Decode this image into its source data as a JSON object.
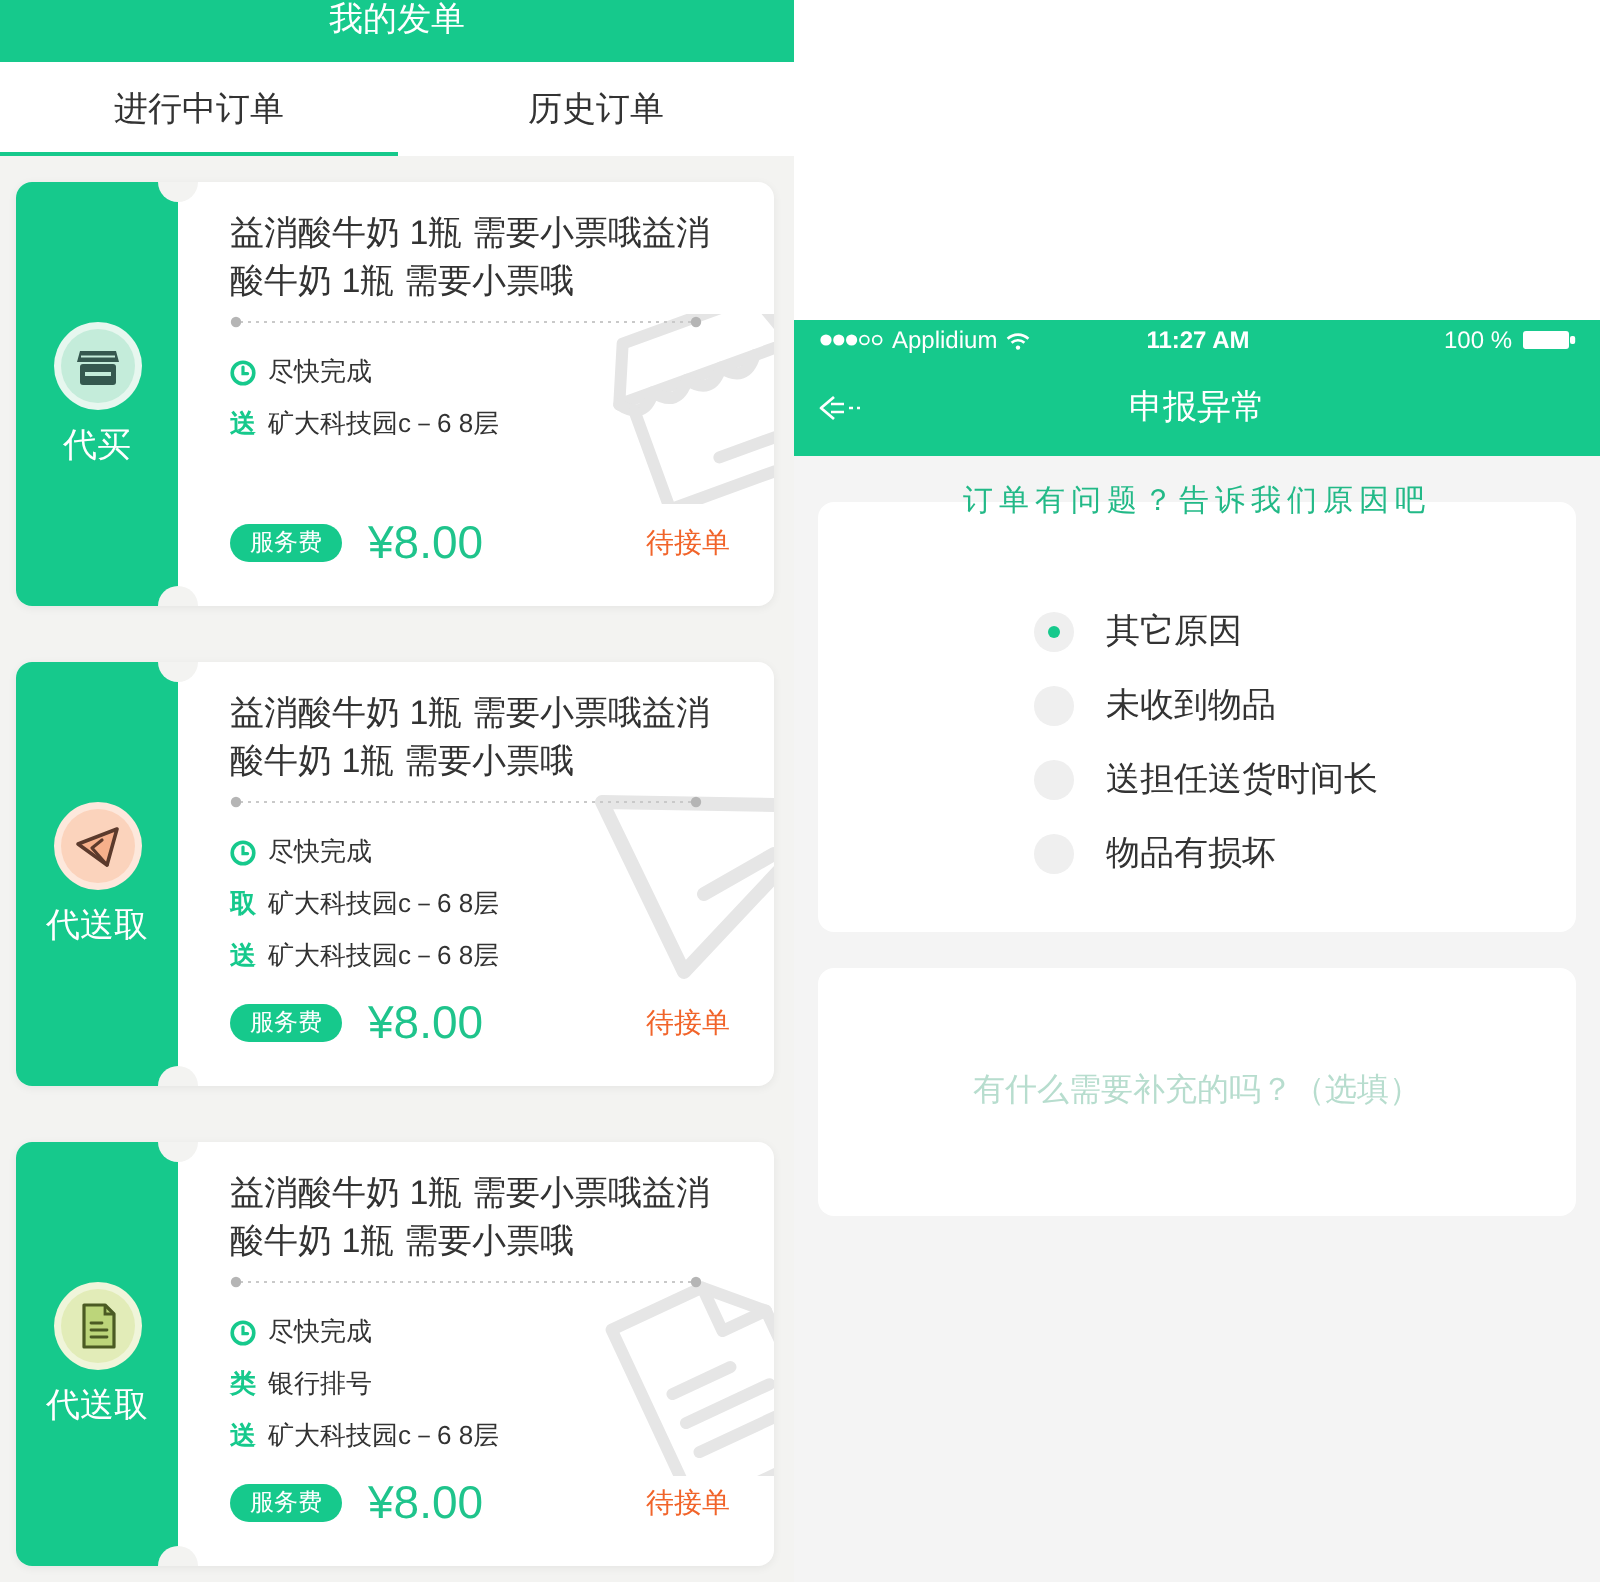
{
  "order_list": {
    "header": {
      "title": "我的发单"
    },
    "tabs": [
      {
        "label": "进行中订单",
        "selected": true
      },
      {
        "label": "历史订单",
        "selected": false
      }
    ],
    "orders": [
      {
        "kind": "shop",
        "service": "代买",
        "description": "益消酸牛奶 1瓶 需要小票哦益消酸牛奶 1瓶 需要小票哦",
        "details": [
          {
            "kind": "time",
            "text": "尽快完成"
          },
          {
            "kind": "labeled",
            "label": "送",
            "text": "矿大科技园c－6 8层"
          }
        ],
        "fee_label": "服务费",
        "price": "¥8.00",
        "status": "待接单"
      },
      {
        "kind": "send",
        "service": "代送取",
        "description": "益消酸牛奶 1瓶 需要小票哦益消酸牛奶 1瓶 需要小票哦",
        "details": [
          {
            "kind": "time",
            "text": "尽快完成"
          },
          {
            "kind": "labeled",
            "label": "取",
            "text": "矿大科技园c－6 8层"
          },
          {
            "kind": "labeled",
            "label": "送",
            "text": "矿大科技园c－6 8层"
          }
        ],
        "fee_label": "服务费",
        "price": "¥8.00",
        "status": "待接单"
      },
      {
        "kind": "document",
        "service": "代送取",
        "description": "益消酸牛奶 1瓶 需要小票哦益消酸牛奶 1瓶 需要小票哦",
        "details": [
          {
            "kind": "time",
            "text": "尽快完成"
          },
          {
            "kind": "labeled",
            "label": "类",
            "text": "银行排号"
          },
          {
            "kind": "labeled",
            "label": "送",
            "text": "矿大科技园c－6 8层"
          }
        ],
        "fee_label": "服务费",
        "price": "¥8.00",
        "status": "待接单"
      }
    ]
  },
  "report": {
    "status_bar": {
      "carrier": "Applidium",
      "time": "11:27 AM",
      "battery": "100 %"
    },
    "nav": {
      "title": "申报异常"
    },
    "prompt": "订单有问题？告诉我们原因吧",
    "reasons": [
      {
        "label": "其它原因",
        "selected": true
      },
      {
        "label": "未收到物品",
        "selected": false
      },
      {
        "label": "送担任送货时间长",
        "selected": false
      },
      {
        "label": "物品有损坏",
        "selected": false
      }
    ],
    "remark": {
      "placeholder": "有什么需要补充的吗？（选填）"
    }
  }
}
